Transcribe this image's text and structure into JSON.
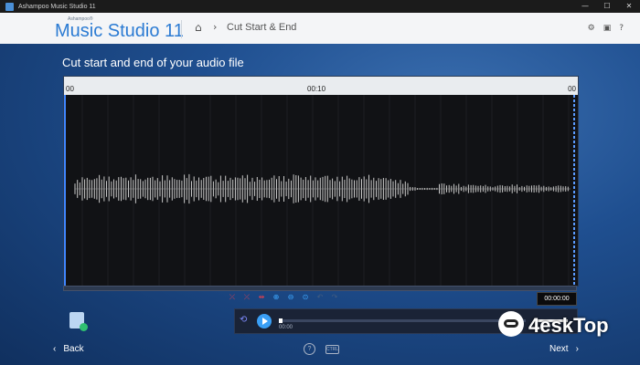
{
  "window": {
    "title": "Ashampoo Music Studio 11",
    "controls": [
      "—",
      "☐",
      "✕"
    ]
  },
  "header": {
    "brand_small": "Ashampoo®",
    "brand": "Music Studio 11",
    "breadcrumb": "Cut Start & End",
    "icons": [
      "gear-icon",
      "image-icon",
      "help-icon"
    ]
  },
  "page": {
    "title": "Cut start and end of your audio file"
  },
  "ruler": {
    "start": "00",
    "mid": "00:10",
    "end": "00"
  },
  "waveform": {
    "envelope": [
      0.45,
      0.6,
      0.52,
      0.7,
      0.62,
      0.5,
      0.66,
      0.58,
      0.72,
      0.5,
      0.64,
      0.55,
      0.68,
      0.6,
      0.5,
      0.74,
      0.62,
      0.58,
      0.7,
      0.48,
      0.66,
      0.57,
      0.63,
      0.71,
      0.55,
      0.6,
      0.5,
      0.69,
      0.64,
      0.52,
      0.78,
      0.6,
      0.66,
      0.58,
      0.72,
      0.54,
      0.61,
      0.67,
      0.5,
      0.63,
      0.7,
      0.56,
      0.6,
      0.52,
      0.45,
      0.38,
      0.1,
      0.05,
      0.05,
      0.05,
      0.3,
      0.2,
      0.25,
      0.15,
      0.22,
      0.18,
      0.2,
      0.12,
      0.2,
      0.16,
      0.22,
      0.14,
      0.18,
      0.2,
      0.15,
      0.12,
      0.18,
      0.14
    ],
    "start_marker": 0.0,
    "end_marker": 1.0
  },
  "toolbar": {
    "buttons": [
      {
        "name": "cut-start-button",
        "glyph": "⤫",
        "color": "red"
      },
      {
        "name": "cut-end-button",
        "glyph": "⤫",
        "color": "red"
      },
      {
        "name": "split-button",
        "glyph": "⇹",
        "color": "red"
      },
      {
        "name": "zoom-in-button",
        "glyph": "⊕",
        "color": "blue"
      },
      {
        "name": "zoom-out-button",
        "glyph": "⊖",
        "color": "blue"
      },
      {
        "name": "zoom-fit-button",
        "glyph": "⊙",
        "color": "blue"
      },
      {
        "name": "undo-button",
        "glyph": "↶",
        "color": "dim"
      },
      {
        "name": "redo-button",
        "glyph": "↷",
        "color": "dim"
      }
    ],
    "time": "00:00:00"
  },
  "player": {
    "time": "00:00",
    "progress": 0.0
  },
  "watermark": {
    "text": "4eskTop"
  },
  "footer": {
    "back": "Back",
    "next": "Next",
    "back_arrow": "‹",
    "next_arrow": "›",
    "help": "?",
    "shortcut": "CTRL"
  },
  "colors": {
    "accent": "#2b7bd3",
    "marker": "#3f86ff",
    "cut": "#e04050"
  }
}
